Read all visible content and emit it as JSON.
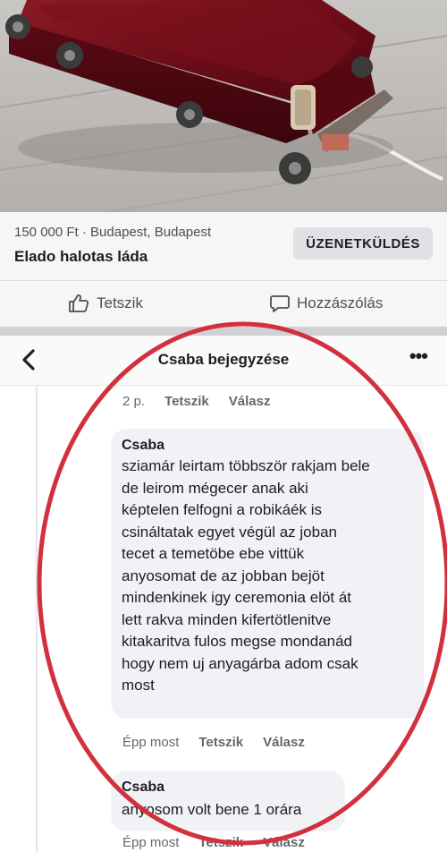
{
  "listing": {
    "price_location": "150 000 Ft · Budapest, Budapest",
    "title": "Elado halotas láda",
    "message_button": "ÜZENETKÜLDÉS",
    "like_label": "Tetszik",
    "comment_label": "Hozzászólás"
  },
  "post": {
    "title": "Csaba bejegyzése"
  },
  "top_meta": {
    "time": "2 p.",
    "like": "Tetszik",
    "reply": "Válasz"
  },
  "comments": [
    {
      "author": "Csaba",
      "text": "sziamár leirtam többször rakjam bele\nde leirom mégecer anak aki\nképtelen felfogni a robikáék is\ncsináltatak egyet végül az joban\ntecet a temetöbe ebe vittük\nanyosomat de az jobban bejöt\nmindenkinek igy ceremonia elöt át\nlett rakva minden kifertötlenitve\nkitakaritva fulos megse mondanád\nhogy nem uj anyagárba adom csak\nmost",
      "time": "Épp most",
      "like": "Tetszik",
      "reply": "Válasz"
    },
    {
      "author": "Csaba",
      "text": "anyosom volt bene 1 orára",
      "time": "Épp most",
      "like": "Tetszik",
      "reply": "Válasz"
    }
  ],
  "colors": {
    "annotation_ring": "#d2303c",
    "coffin": "#6e0d18"
  }
}
